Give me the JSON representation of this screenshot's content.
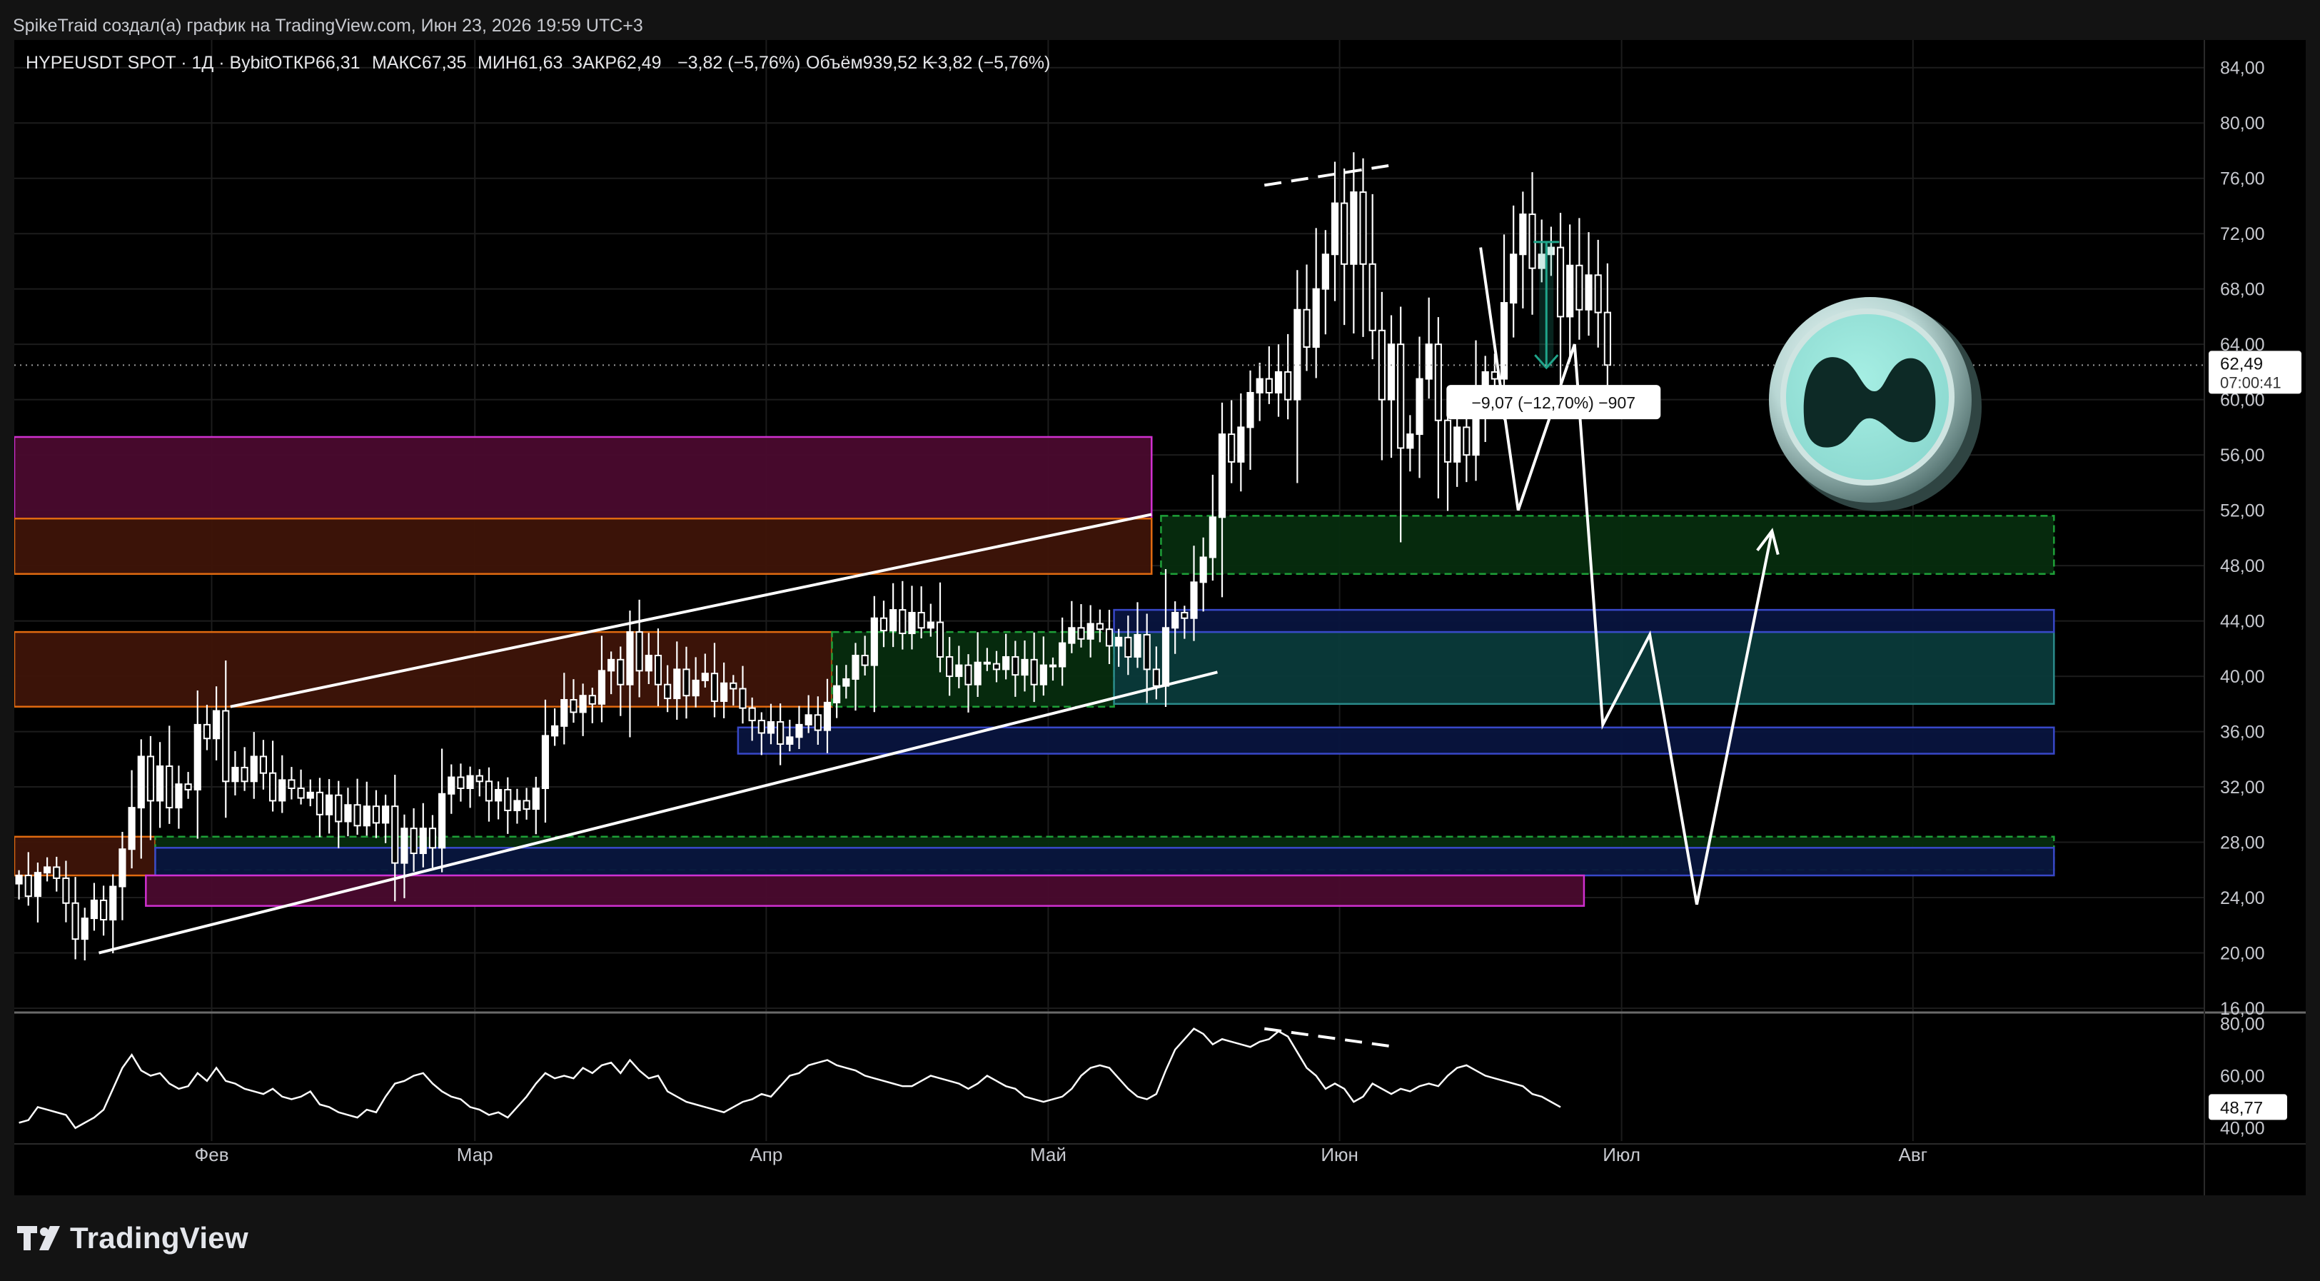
{
  "header": {
    "attribution": "SpikeTraid создал(а) график на TradingView.com, Июн 23, 2026 19:59 UTC+3"
  },
  "legend": {
    "symbol": "HYPEUSDT SPOT · 1Д · Bybit",
    "open_label": "ОТКР",
    "open_value": "66,31",
    "high_label": "МАКС",
    "high_value": "67,35",
    "low_label": "МИН",
    "low_value": "61,63",
    "close_label": "ЗАКР",
    "close_value": "62,49",
    "change": "−3,82 (−5,76%)",
    "volume_label": "Объём",
    "volume_value": "939,52 K",
    "volume_change": "−3,82 (−5,76%)"
  },
  "price_tag": {
    "price": "62,49",
    "countdown": "07:00:41"
  },
  "measure_label": "−9,07 (−12,70%) −907",
  "rsi_tag": "48,77",
  "footer": {
    "brand": "TradingView"
  },
  "colors": {
    "background": "#000000",
    "candle": "#ffffff",
    "purple_zone": "#d020d0",
    "orange_zone": "#e06a10",
    "green_zone": "#1a8a2a",
    "blue_zone": "#2a3aa8",
    "measure": "#1fa58a"
  },
  "chart_data": {
    "type": "candlestick",
    "symbol": "HYPEUSDT",
    "interval": "1Д",
    "y_axis": {
      "ticks": [
        "84,00",
        "80,00",
        "76,00",
        "72,00",
        "68,00",
        "64,00",
        "60,00",
        "56,00",
        "52,00",
        "48,00",
        "44,00",
        "40,00",
        "36,00",
        "32,00",
        "28,00",
        "24,00",
        "20,00",
        "16,00"
      ],
      "range": [
        16,
        86
      ]
    },
    "x_axis": {
      "ticks": [
        {
          "label": "Фев",
          "day": 21
        },
        {
          "label": "Мар",
          "day": 49
        },
        {
          "label": "Апр",
          "day": 80
        },
        {
          "label": "Май",
          "day": 110
        },
        {
          "label": "Июн",
          "day": 141
        },
        {
          "label": "Июл",
          "day": 171
        },
        {
          "label": "Авг",
          "day": 202
        }
      ],
      "range": [
        0,
        233
      ]
    },
    "close_series": [
      25.6,
      24.1,
      25.8,
      26.2,
      25.4,
      23.6,
      21.0,
      22.5,
      23.8,
      22.4,
      24.8,
      27.5,
      30.5,
      34.2,
      31.0,
      33.5,
      30.5,
      32.2,
      31.8,
      36.5,
      35.5,
      37.5,
      32.4,
      33.4,
      32.4,
      34.2,
      33.0,
      31.0,
      32.5,
      31.9,
      31.2,
      31.6,
      30.0,
      31.4,
      29.5,
      30.7,
      29.2,
      30.6,
      29.4,
      30.6,
      26.5,
      29.0,
      27.2,
      29.0,
      27.6,
      31.5,
      32.7,
      31.9,
      32.8,
      32.4,
      31.0,
      31.8,
      30.3,
      31.0,
      30.4,
      31.9,
      35.7,
      36.4,
      38.3,
      37.4,
      38.6,
      38.0,
      40.4,
      41.2,
      39.4,
      43.2,
      40.4,
      41.5,
      39.4,
      38.4,
      40.5,
      38.6,
      39.7,
      40.2,
      38.2,
      39.5,
      39.1,
      37.7,
      36.8,
      35.9,
      36.7,
      35.1,
      35.6,
      36.5,
      37.2,
      36.1,
      38.1,
      39.3,
      39.8,
      41.5,
      40.8,
      44.2,
      43.3,
      44.8,
      43.1,
      44.6,
      43.5,
      43.9,
      41.4,
      40.0,
      40.8,
      39.4,
      41.0,
      40.9,
      40.5,
      41.4,
      40.1,
      41.2,
      39.4,
      40.8,
      40.7,
      42.4,
      43.5,
      42.7,
      43.8,
      43.4,
      42.2,
      42.8,
      41.4,
      43.0,
      40.5,
      39.3,
      43.5,
      44.6,
      44.2,
      46.8,
      48.6,
      51.5,
      57.5,
      55.5,
      58.0,
      60.5,
      61.5,
      60.5,
      62.0,
      60.0,
      66.5,
      63.8,
      68.0,
      70.5,
      74.2,
      69.8,
      75.0,
      69.8,
      65.0,
      60.0,
      64.0,
      56.5,
      57.5,
      61.5,
      64.0,
      58.5,
      55.5,
      58.0,
      56.0,
      60.0,
      62.0,
      61.5,
      67.0,
      70.5,
      73.4,
      69.5,
      70.5,
      71.0,
      66.0,
      69.7,
      66.5,
      69.0,
      66.3,
      62.5
    ],
    "indicator": {
      "name": "RSI",
      "ticks": [
        "80,00",
        "60,00",
        "40,00"
      ],
      "range": [
        35,
        82
      ],
      "last_value": "48,77",
      "values": [
        42,
        43,
        48,
        47,
        46,
        45,
        40,
        42,
        44,
        47,
        55,
        63,
        68,
        62,
        60,
        61,
        57,
        55,
        56,
        61,
        58,
        63,
        58,
        57,
        55,
        54,
        53,
        55,
        52,
        51,
        52,
        54,
        49,
        48,
        46,
        45,
        44,
        47,
        46,
        52,
        57,
        58,
        60,
        61,
        57,
        54,
        52,
        51,
        48,
        47,
        45,
        46,
        44,
        48,
        52,
        57,
        61,
        59,
        60,
        59,
        63,
        61,
        64,
        65,
        61,
        66,
        62,
        59,
        60,
        54,
        52,
        50,
        49,
        48,
        47,
        46,
        48,
        50,
        51,
        53,
        52,
        56,
        60,
        61,
        64,
        65,
        66,
        64,
        63,
        62,
        60,
        59,
        58,
        57,
        56,
        56,
        58,
        60,
        59,
        58,
        57,
        55,
        57,
        60,
        58,
        56,
        55,
        52,
        51,
        50,
        51,
        52,
        55,
        60,
        63,
        64,
        63,
        59,
        55,
        52,
        51,
        53,
        62,
        70,
        74,
        78,
        76,
        72,
        74,
        73,
        72,
        71,
        73,
        74,
        77,
        75,
        69,
        63,
        60,
        55,
        57,
        55,
        50,
        52,
        57,
        55,
        53,
        55,
        54,
        56,
        57,
        56,
        60,
        63,
        64,
        62,
        60,
        59,
        58,
        57,
        56,
        53,
        52,
        50,
        48
      ]
    },
    "drawings": {
      "channel_upper": [
        [
          23,
          37.8
        ],
        [
          121,
          51.7
        ]
      ],
      "channel_lower": [
        [
          9,
          20.0
        ],
        [
          128,
          40.3
        ]
      ],
      "projection_path": [
        [
          156,
          71.0
        ],
        [
          160,
          52.0
        ],
        [
          166,
          64.0
        ],
        [
          169,
          36.5
        ],
        [
          174,
          43.0
        ],
        [
          179,
          23.5
        ],
        [
          187,
          50.5
        ]
      ],
      "divergence_price": [
        [
          133,
          75.5
        ],
        [
          147,
          77.0
        ]
      ],
      "divergence_rsi": [
        [
          133,
          78
        ],
        [
          147,
          71
        ]
      ],
      "measure": {
        "from_price": 71.4,
        "to_price": 62.3,
        "day": 163
      },
      "zones": [
        {
          "kind": "purple",
          "top": 57.3,
          "bottom": 51.4,
          "from": 0,
          "to": 121
        },
        {
          "kind": "orange",
          "top": 51.4,
          "bottom": 47.4,
          "from": 0,
          "to": 121
        },
        {
          "kind": "orange",
          "top": 43.2,
          "bottom": 37.8,
          "from": 0,
          "to": 87
        },
        {
          "kind": "orange",
          "top": 28.4,
          "bottom": 25.6,
          "from": 0,
          "to": 15
        },
        {
          "kind": "green",
          "top": 51.6,
          "bottom": 47.4,
          "from": 122,
          "to": 217
        },
        {
          "kind": "green",
          "top": 43.2,
          "bottom": 37.8,
          "from": 87,
          "to": 117
        },
        {
          "kind": "green",
          "top": 28.4,
          "bottom": 26.0,
          "from": 15,
          "to": 217
        },
        {
          "kind": "teal",
          "top": 43.2,
          "bottom": 38.0,
          "from": 117,
          "to": 217
        },
        {
          "kind": "blue",
          "top": 44.8,
          "bottom": 43.2,
          "from": 117,
          "to": 217
        },
        {
          "kind": "blue",
          "top": 36.3,
          "bottom": 34.4,
          "from": 77,
          "to": 217
        },
        {
          "kind": "blue",
          "top": 27.6,
          "bottom": 25.6,
          "from": 15,
          "to": 217
        },
        {
          "kind": "purple",
          "top": 25.6,
          "bottom": 23.4,
          "from": 14,
          "to": 167
        }
      ]
    }
  }
}
